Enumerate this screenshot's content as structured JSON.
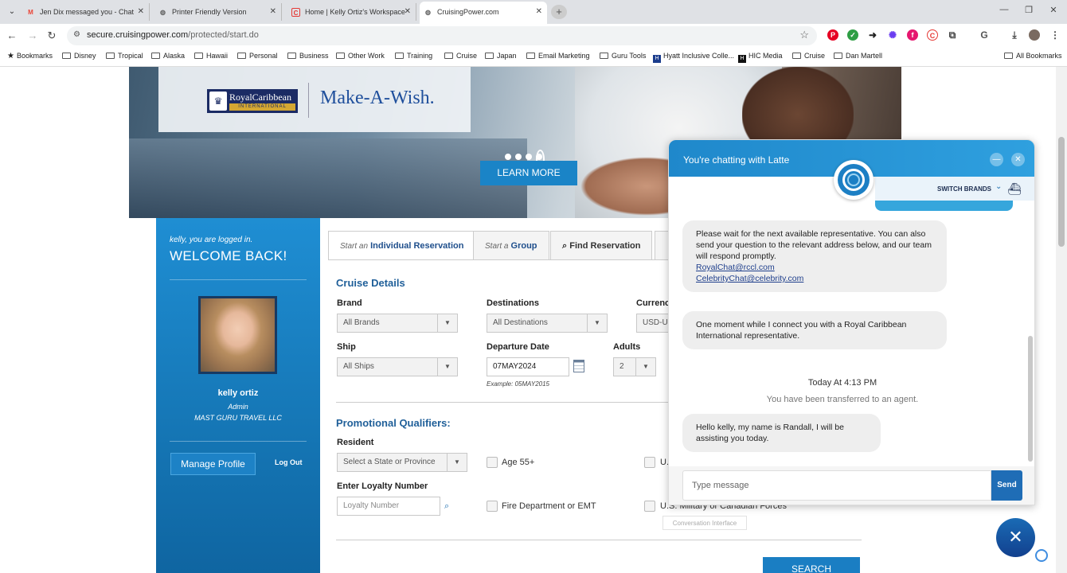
{
  "browser": {
    "tabs": [
      {
        "title": "Jen Dix messaged you - Chat",
        "fav": "M",
        "fav_color": "#ea4335"
      },
      {
        "title": "Printer Friendly Version",
        "fav": "◍",
        "fav_color": "#666666"
      },
      {
        "title": "Home | Kelly Ortiz's Workspace",
        "fav": "C",
        "fav_color": "#e53935"
      },
      {
        "title": "CruisingPower.com",
        "fav": "◍",
        "fav_color": "#666666"
      }
    ],
    "new_tab": "+",
    "win": {
      "min": "—",
      "max": "❐",
      "close": "✕"
    },
    "url_host": "secure.cruisingpower.com",
    "url_path": "/protected/start.do",
    "bookmarks": [
      "Bookmarks",
      "Disney",
      "Tropical",
      "Alaska",
      "Hawaii",
      "Personal",
      "Business",
      "Other Work",
      "Training",
      "Cruise",
      "Japan",
      "Email Marketing",
      "Guru Tools",
      "Hyatt Inclusive Colle...",
      "HIC Media",
      "Cruise",
      "Dan Martell"
    ],
    "all_bookmarks": "All Bookmarks"
  },
  "hero": {
    "brand_name": "RoyalCaribbean",
    "brand_intl": "INTERNATIONAL",
    "partner": "Make-A-Wish.",
    "learn_more": "LEARN MORE"
  },
  "welcome": {
    "logged_in": "kelly, you are logged in.",
    "title": "WELCOME BACK!",
    "name": "kelly ortiz",
    "role": "Admin",
    "agency": "MAST GURU TRAVEL LLC",
    "manage_profile": "Manage Profile",
    "log_out": "Log Out"
  },
  "form": {
    "tabs": [
      {
        "pre": "Start an",
        "main": "Individual Reservation"
      },
      {
        "pre": "Start a",
        "main": "Group"
      },
      {
        "pre": "",
        "main": "Find Reservation"
      }
    ],
    "cruise_details": "Cruise Details",
    "brand_label": "Brand",
    "brand_value": "All Brands",
    "destinations_label": "Destinations",
    "destinations_value": "All Destinations",
    "currency_label": "Currenc",
    "currency_value": "USD-U",
    "ship_label": "Ship",
    "ship_value": "All Ships",
    "departure_label": "Departure Date",
    "departure_value": "07MAY2024",
    "departure_example": "Example: 05MAY2015",
    "adults_label": "Adults",
    "adults_value": "2",
    "promo_title": "Promotional Qualifiers:",
    "resident_label": "Resident",
    "resident_placeholder": "Select a State or Province",
    "age55": "Age 55+",
    "u_trunc": "U.",
    "loyalty_label": "Enter Loyalty Number",
    "loyalty_placeholder": "Loyalty Number",
    "fire": "Fire Department or EMT",
    "military": "U.S. Military or Canadian Forces",
    "conversation_interface": "Conversation Interface",
    "search": "SEARCH"
  },
  "chat": {
    "title": "You're chatting with Latte",
    "switch_brands": "SWITCH BRANDS",
    "msg1": "Please wait for the next available representative. You can also send your question to the relevant address below, and our team will respond promptly.",
    "email1": "RoyalChat@rccl.com",
    "email2": "CelebrityChat@celebrity.com",
    "msg2": "One moment while I connect you with a Royal Caribbean International representative.",
    "timestamp": "Today At 4:13 PM",
    "system": "You have been transferred to an agent.",
    "msg3": "Hello kelly, my name is Randall, I will be assisting you today.",
    "input_placeholder": "Type message",
    "send": "Send"
  }
}
